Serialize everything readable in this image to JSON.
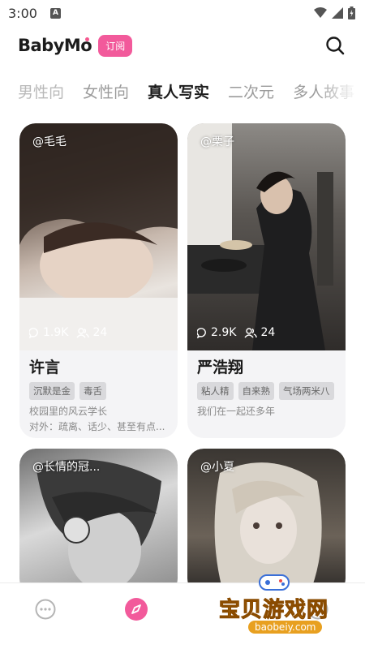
{
  "status_bar": {
    "time": "3:00",
    "notification_letter": "A"
  },
  "header": {
    "logo": "BabyMo",
    "subscribe_label": "订阅"
  },
  "tabs": [
    {
      "label": "男性向"
    },
    {
      "label": "女性向"
    },
    {
      "label": "真人写实"
    },
    {
      "label": "二次元"
    },
    {
      "label": "多人故事"
    }
  ],
  "cards": [
    {
      "creator": "@毛毛",
      "messages": "1.9K",
      "followers": "24",
      "name": "许言",
      "tags": [
        "沉默是金",
        "毒舌"
      ],
      "desc1": "校园里的风云学长",
      "desc2": "对外：疏离、话少、甚至有点..."
    },
    {
      "creator": "@栗子",
      "messages": "2.9K",
      "followers": "24",
      "name": "严浩翔",
      "tags": [
        "粘人精",
        "自来熟",
        "气场两米八"
      ],
      "desc1": "我们在一起还多年"
    },
    {
      "creator": "@长情的冠..."
    },
    {
      "creator": "@小夏"
    }
  ],
  "watermark": {
    "text": "宝贝游戏网",
    "url": "baobeiy.com"
  },
  "icons": {
    "search": "search-icon",
    "chat": "chat-icon",
    "discover": "compass-icon",
    "profile": "profile-icon"
  },
  "colors": {
    "accent": "#f25a9b"
  }
}
